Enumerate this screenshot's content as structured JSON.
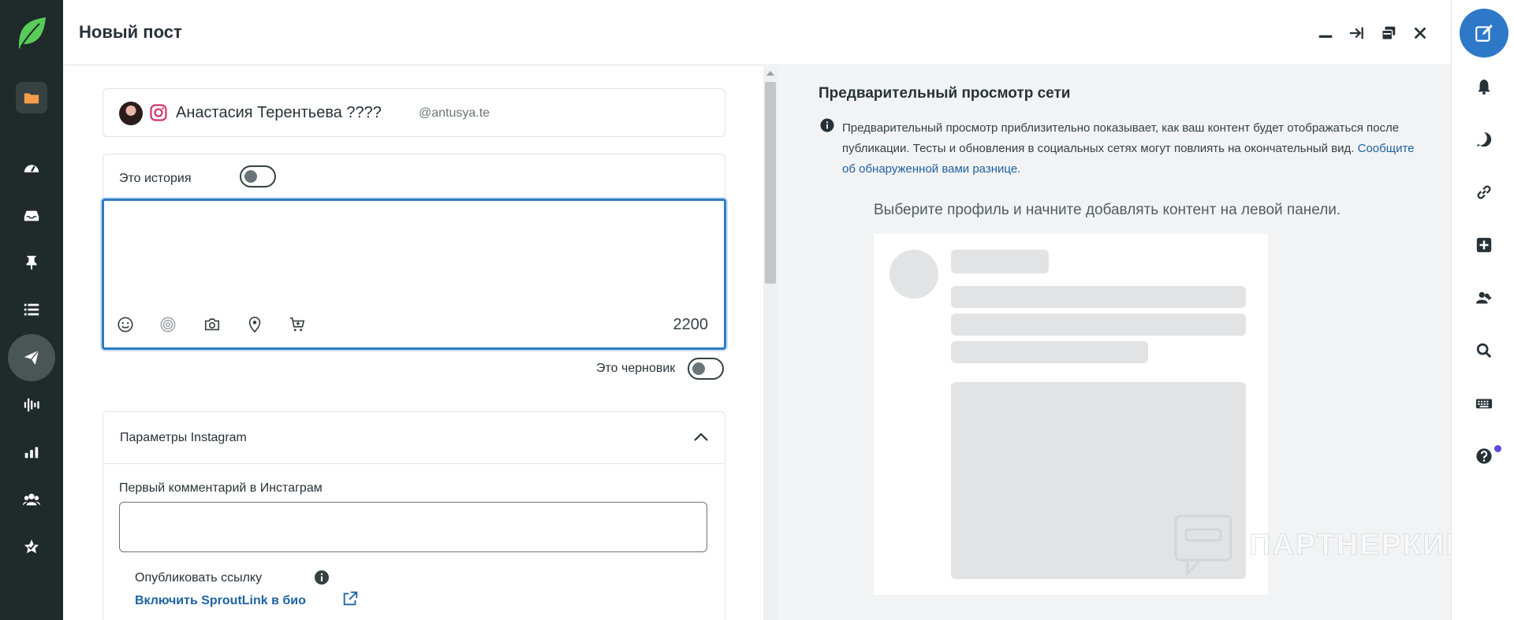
{
  "header": {
    "title": "Новый пост",
    "buttons": [
      "minimize-icon",
      "collapse-to-right-icon",
      "duplicate-icon",
      "close-icon"
    ]
  },
  "left_nav": {
    "items": [
      "folder-icon",
      "gauge-icon",
      "inbox-icon",
      "pin-icon",
      "list-icon",
      "send-icon",
      "audio-waves-icon",
      "bar-chart-icon",
      "users-icon",
      "star-check-icon"
    ],
    "active": "send-icon",
    "folder_color": "#f59d4a"
  },
  "profile": {
    "name": "Анастасия Терентьева ????",
    "handle": "@antusya.te",
    "network": "instagram-icon"
  },
  "composer": {
    "story_label": "Это история",
    "story_on": false,
    "text": "",
    "char_count": "2200",
    "tools": [
      "emoji-icon",
      "target-icon",
      "camera-icon",
      "location-pin-icon",
      "cart-icon"
    ],
    "draft_label": "Это черновик",
    "draft_on": false
  },
  "instagram_params": {
    "title": "Параметры Instagram",
    "first_comment_label": "Первый комментарий в Инстаграм",
    "first_comment_value": "",
    "publish_link_label": "Опубликовать ссылку",
    "sproutlink_text": "Включить SproutLink в био"
  },
  "preview": {
    "title": "Предварительный просмотр сети",
    "description": "Предварительный просмотр приблизительно показывает, как ваш контент будет отображаться после публикации. Тесты и обновления в социальных сетях могут повлиять на окончательный вид.",
    "report_link": "Сообщите об обнаруженной вами разнице.",
    "hint": "Выберите профиль и начните добавлять контент на левой панели."
  },
  "watermark": {
    "text": "ПАРТНЕРКИН"
  },
  "right_nav": {
    "compose": "compose-icon",
    "items": [
      "bell-icon",
      "activity-icon",
      "link-icon",
      "plus-square-icon",
      "user-plus-icon",
      "search-icon",
      "keyboard-icon",
      "help-icon"
    ]
  },
  "colors": {
    "accent": "#2d79c7",
    "link": "#1e62a3",
    "sidebar": "#1f2a2a",
    "brand_green": "#59cb59"
  }
}
